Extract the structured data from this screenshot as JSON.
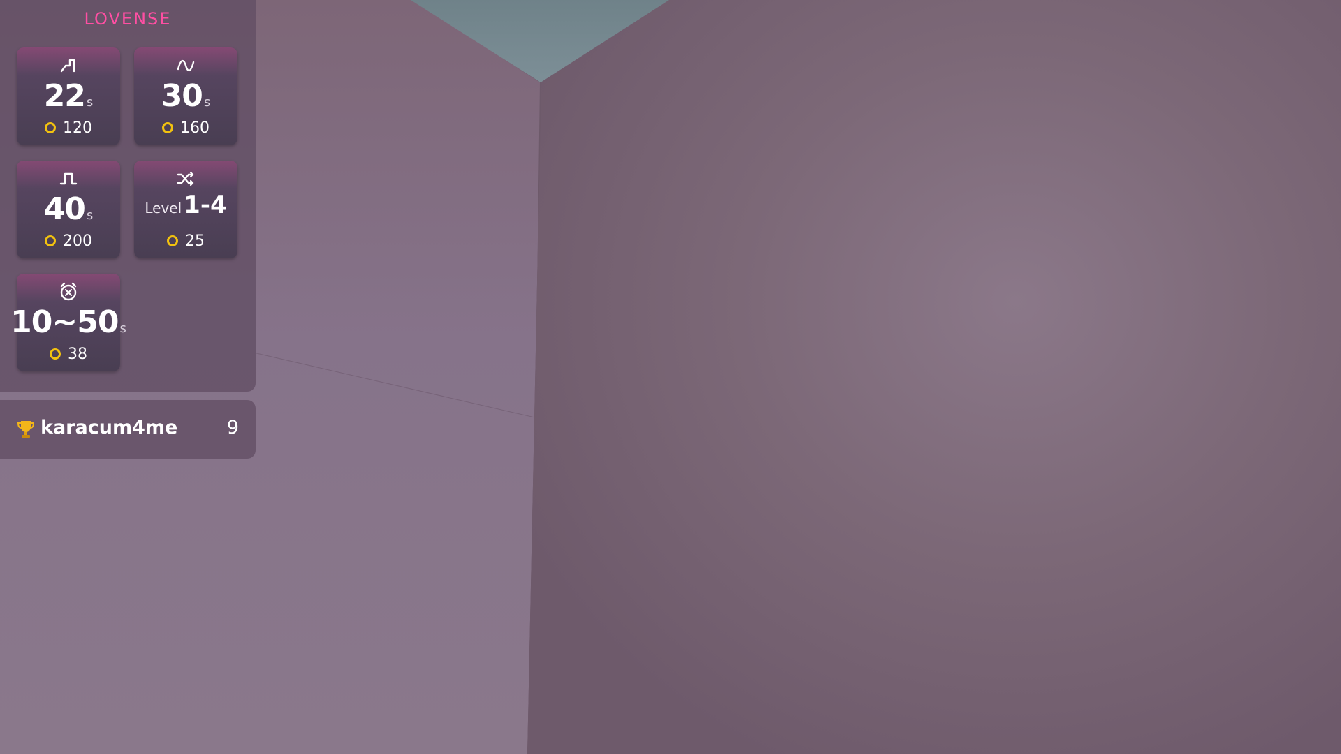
{
  "brand": {
    "name": "LOVENSE",
    "color": "#ff4fa3"
  },
  "tiles": [
    {
      "icon": "pulse-step-icon",
      "value": "22",
      "unit": "s",
      "price": "120"
    },
    {
      "icon": "wave-icon",
      "value": "30",
      "unit": "s",
      "price": "160"
    },
    {
      "icon": "square-wave-icon",
      "value": "40",
      "unit": "s",
      "price": "200"
    },
    {
      "icon": "shuffle-icon",
      "level_label": "Level",
      "value": "1-4",
      "price": "25"
    },
    {
      "icon": "alarm-clock-icon",
      "value": "10~50",
      "unit": "s",
      "price": "38"
    }
  ],
  "leaderboard": {
    "icon": "trophy-icon",
    "name": "karacum4me",
    "count": "9"
  },
  "colors": {
    "coin": "#f2c20f",
    "panel_bg": "#624e64"
  }
}
